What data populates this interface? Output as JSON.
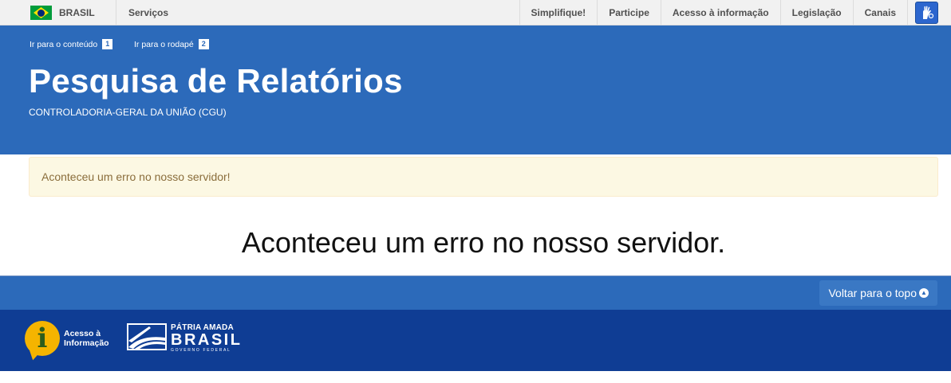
{
  "govbar": {
    "brand": "BRASIL",
    "services": "Serviços",
    "links": [
      "Simplifique!",
      "Participe",
      "Acesso à informação",
      "Legislação",
      "Canais"
    ]
  },
  "header": {
    "skip_content": "Ir para o conteúdo",
    "skip_content_key": "1",
    "skip_footer": "Ir para o rodapé",
    "skip_footer_key": "2",
    "title": "Pesquisa de Relatórios",
    "subtitle": "CONTROLADORIA-GERAL DA UNIÃO (CGU)"
  },
  "alert": {
    "message": "Aconteceu um erro no nosso servidor!"
  },
  "main": {
    "heading": "Aconteceu um erro no nosso servidor."
  },
  "footer": {
    "back_to_top": "Voltar para o topo",
    "acesso_line1": "Acesso à",
    "acesso_line2": "Informação",
    "patria_top": "PÁTRIA AMADA",
    "patria_brasil": "BRASIL",
    "patria_gov": "GOVERNO FEDERAL"
  },
  "colors": {
    "header_blue": "#2c6aba",
    "footer_dark_blue": "#0f3d94",
    "alert_bg": "#fcf8e3",
    "alert_text": "#8a6d3b"
  },
  "icons": [
    "brazil-flag-icon",
    "vlibras-hands-icon",
    "chevron-up-circle-icon",
    "acesso-informacao-logo",
    "patria-amada-brasil-logo"
  ]
}
